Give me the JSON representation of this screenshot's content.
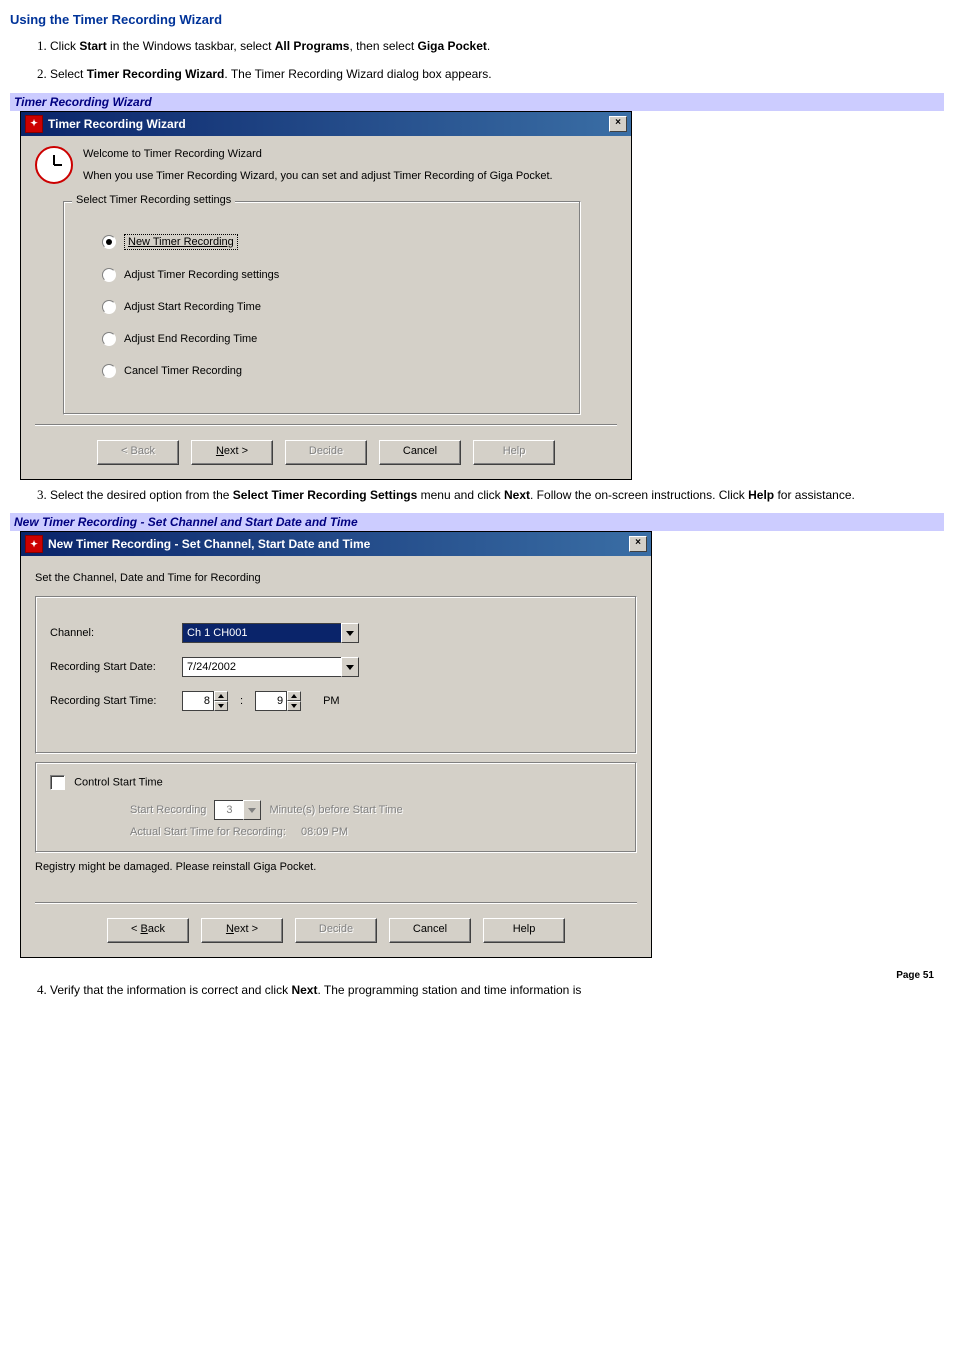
{
  "heading": "Using the Timer Recording Wizard",
  "steps": {
    "s1_pre": "Click ",
    "s1_b1": "Start",
    "s1_mid1": " in the Windows taskbar, select ",
    "s1_b2": "All Programs",
    "s1_mid2": ", then select ",
    "s1_b3": "Giga Pocket",
    "s1_end": ".",
    "s2_pre": "Select ",
    "s2_b1": "Timer Recording Wizard",
    "s2_end": ". The Timer Recording Wizard dialog box appears.",
    "s3_pre": "Select the desired option from the ",
    "s3_b1": "Select Timer Recording Settings",
    "s3_mid1": " menu and click ",
    "s3_b2": "Next",
    "s3_mid2": ". Follow the on-screen instructions. Click ",
    "s3_b3": "Help",
    "s3_end": " for assistance.",
    "s4_pre": "Verify that the information is correct and click ",
    "s4_b1": "Next",
    "s4_end": ". The programming station and time information is"
  },
  "caption1": "Timer Recording Wizard",
  "caption2": "New Timer Recording - Set Channel and Start Date and Time",
  "dialog1": {
    "title": "Timer Recording Wizard",
    "close": "×",
    "intro1": "Welcome to Timer Recording Wizard",
    "intro2": "When you use Timer Recording Wizard, you can set and adjust Timer Recording of Giga Pocket.",
    "group_legend": "Select Timer Recording settings",
    "radios": {
      "r1": "New Timer Recording",
      "r2": "Adjust Timer Recording settings",
      "r3": "Adjust Start Recording Time",
      "r4": "Adjust End Recording Time",
      "r5": "Cancel Timer Recording"
    },
    "buttons": {
      "back": "< Back",
      "next_u": "N",
      "next_rest": "ext >",
      "decide": "Decide",
      "cancel": "Cancel",
      "help": "Help"
    }
  },
  "dialog2": {
    "title": "New Timer Recording - Set Channel, Start Date and Time",
    "close": "×",
    "instruction": "Set the Channel, Date and Time for Recording",
    "labels": {
      "channel": "Channel:",
      "start_date": "Recording Start Date:",
      "start_time": "Recording Start Time:",
      "pm": "PM",
      "control": "Control Start Time",
      "start_rec": "Start Recording",
      "minutes_before": "Minute(s) before Start Time",
      "actual_label": "Actual Start Time for Recording:",
      "actual_value": "08:09 PM"
    },
    "values": {
      "channel": "Ch 1 CH001",
      "date": "7/24/2002",
      "hour": "8",
      "minute": "9",
      "lead": "3"
    },
    "warning": "Registry might be damaged. Please reinstall Giga Pocket.",
    "buttons": {
      "back_u": "B",
      "back_rest": "ack",
      "back_pre": "< ",
      "next_u": "N",
      "next_rest": "ext >",
      "decide": "Decide",
      "cancel": "Cancel",
      "help": "Help"
    }
  },
  "footer": "Page 51"
}
